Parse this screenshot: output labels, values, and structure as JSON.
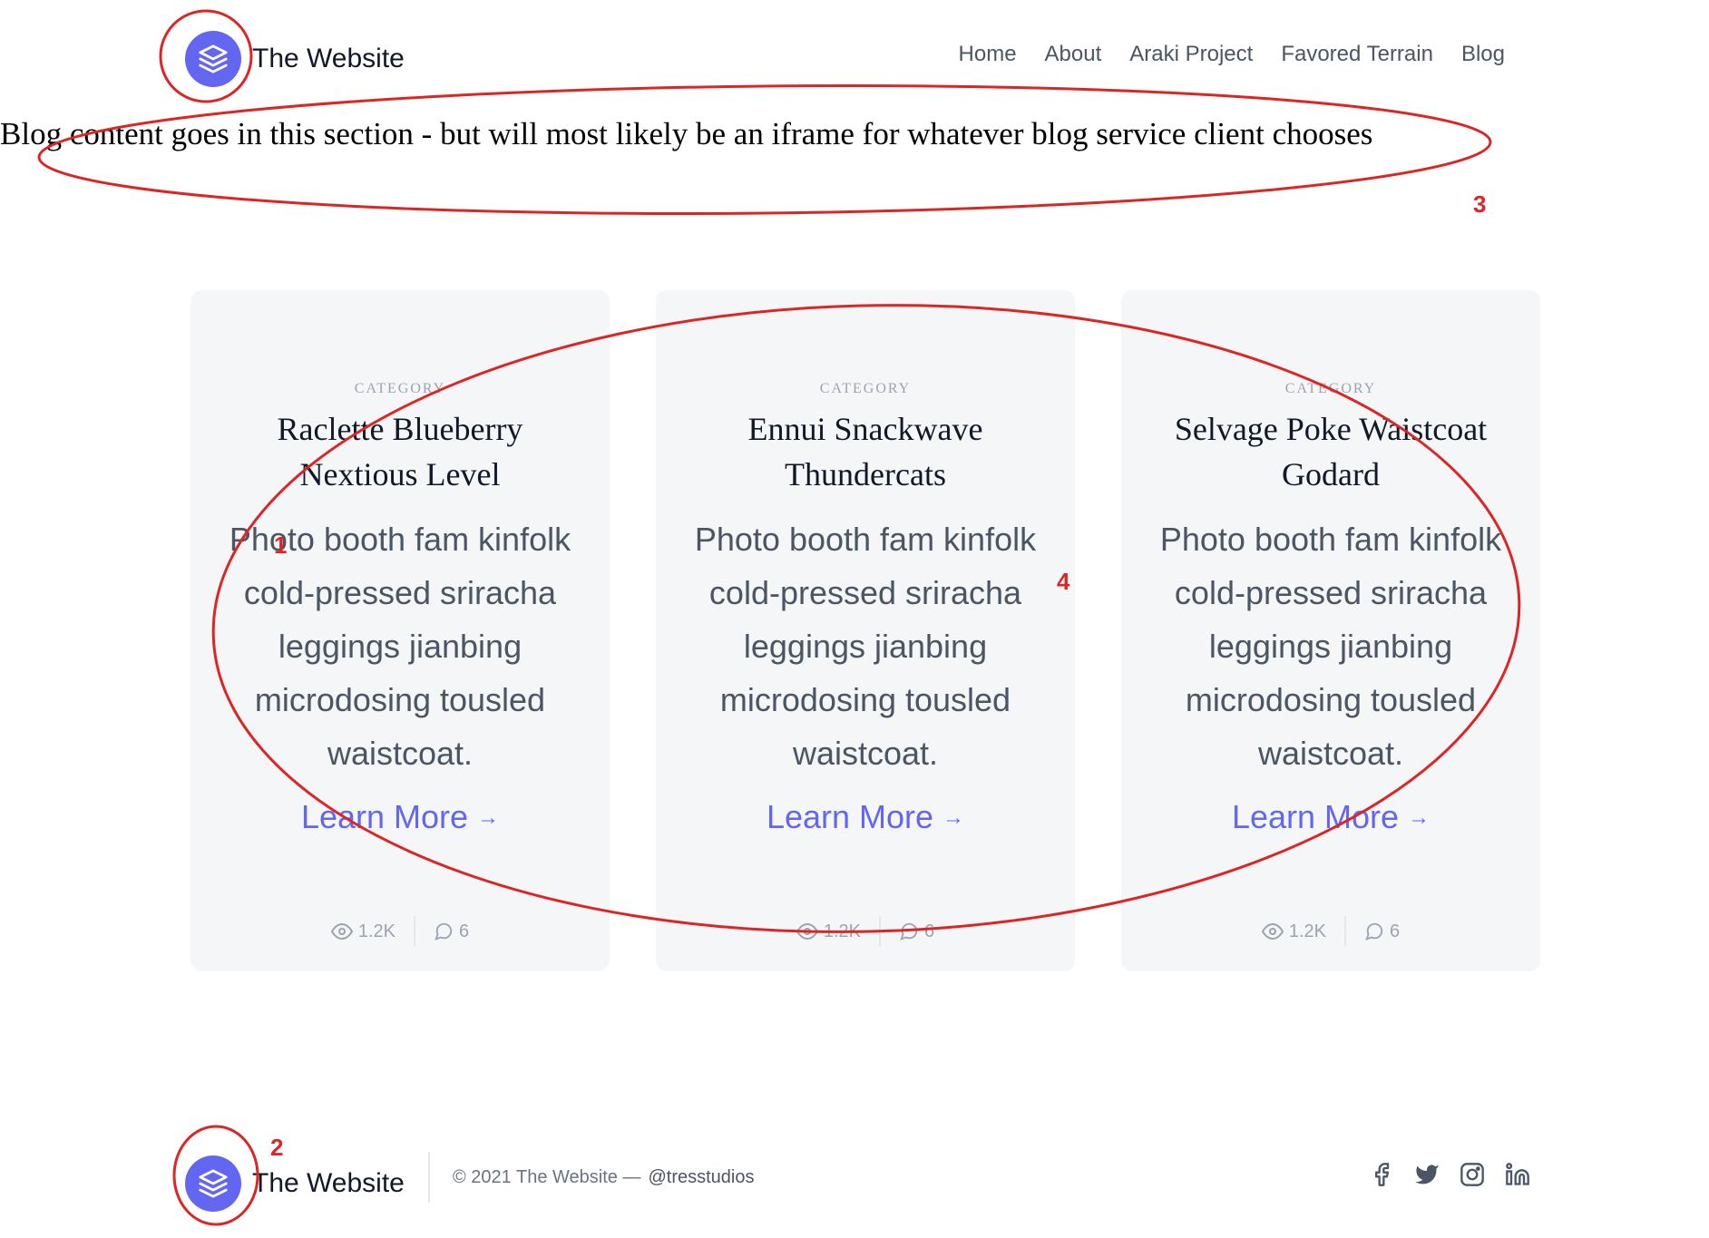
{
  "header": {
    "logo_icon": "layers-icon",
    "site_name": "The Website",
    "nav": [
      "Home",
      "About",
      "Araki Project",
      "Favored Terrain",
      "Blog"
    ]
  },
  "blog_note": "Blog content goes in this section - but will most likely be an iframe for whatever blog service client chooses",
  "cards": [
    {
      "category": "CATEGORY",
      "title": "Raclette Blueberry Nextious Level",
      "body": "Photo booth fam kinfolk cold-pressed sriracha leggings jianbing microdosing tousled waistcoat.",
      "link": "Learn More",
      "views": "1.2K",
      "comments": "6"
    },
    {
      "category": "CATEGORY",
      "title": "Ennui Snackwave Thundercats",
      "body": "Photo booth fam kinfolk cold-pressed sriracha leggings jianbing microdosing tousled waistcoat.",
      "link": "Learn More",
      "views": "1.2K",
      "comments": "6"
    },
    {
      "category": "CATEGORY",
      "title": "Selvage Poke Waistcoat Godard",
      "body": "Photo booth fam kinfolk cold-pressed sriracha leggings jianbing microdosing tousled waistcoat.",
      "link": "Learn More",
      "views": "1.2K",
      "comments": "6"
    }
  ],
  "footer": {
    "site_name": "The Website",
    "copyright": "© 2021 The Website —",
    "handle": "@tresstudios",
    "social_icons": [
      "facebook-icon",
      "twitter-icon",
      "instagram-icon",
      "linkedin-icon"
    ]
  },
  "annotations": {
    "color": "#dc2626",
    "labels": [
      "1",
      "2",
      "3",
      "4"
    ]
  },
  "colors": {
    "accent": "#6366f1",
    "card_bg": "#f5f6f8",
    "text_muted": "#9ca3af"
  }
}
